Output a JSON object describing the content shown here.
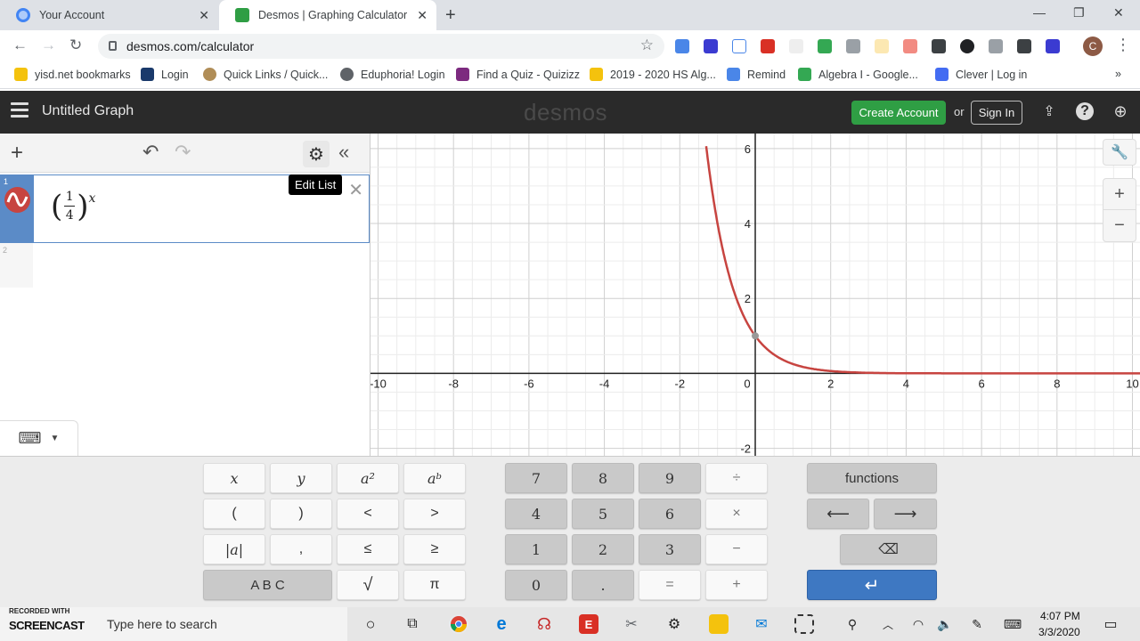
{
  "browser": {
    "tabs": [
      {
        "title": "Your Account"
      },
      {
        "title": "Desmos | Graphing Calculator"
      }
    ],
    "url": "desmos.com/calculator",
    "profile_initial": "C",
    "bookmarks": [
      {
        "label": "yisd.net bookmarks"
      },
      {
        "label": "Login"
      },
      {
        "label": "Quick Links / Quick..."
      },
      {
        "label": "Eduphoria! Login"
      },
      {
        "label": "Find a Quiz - Quizizz"
      },
      {
        "label": "2019 - 2020 HS Alg..."
      },
      {
        "label": "Remind"
      },
      {
        "label": "Algebra I - Google..."
      },
      {
        "label": "Clever | Log in"
      }
    ]
  },
  "desmos": {
    "graph_title": "Untitled Graph",
    "logo": "desmos",
    "create_account": "Create Account",
    "or": "or",
    "sign_in": "Sign In",
    "tooltip": "Edit List",
    "expressions": [
      {
        "index": "1",
        "numerator": "1",
        "denominator": "4",
        "exponent": "x",
        "color": "#c74440"
      },
      {
        "index": "2"
      }
    ]
  },
  "chart_data": {
    "type": "line",
    "title": "",
    "xlabel": "",
    "ylabel": "",
    "xlim": [
      -10.2,
      10.2
    ],
    "ylim": [
      -2.2,
      6.4
    ],
    "x_ticks": [
      "-10",
      "-8",
      "-6",
      "-4",
      "-2",
      "0",
      "2",
      "4",
      "6",
      "8",
      "10"
    ],
    "y_ticks": [
      "-2",
      "2",
      "4",
      "6"
    ],
    "grid": true,
    "series": [
      {
        "function": "(1/4)^x",
        "color": "#c74440",
        "x": [
          -1.3,
          -1.2,
          -1.0,
          -0.8,
          -0.6,
          -0.4,
          -0.2,
          0,
          0.25,
          0.5,
          0.75,
          1,
          1.5,
          2,
          2.5,
          3,
          4,
          5,
          6,
          8,
          10.2
        ],
        "y": [
          6.06,
          5.28,
          4.0,
          3.03,
          2.3,
          1.74,
          1.32,
          1.0,
          0.71,
          0.5,
          0.35,
          0.25,
          0.125,
          0.0625,
          0.031,
          0.016,
          0.004,
          0.001,
          0.0002,
          0.0,
          0.0
        ]
      }
    ],
    "highlight_point": {
      "x": 0,
      "y": 1
    }
  },
  "keypad": {
    "left": [
      [
        "x",
        "y",
        "a²",
        "aᵇ"
      ],
      [
        "(",
        ")",
        "<",
        ">"
      ],
      [
        "|a|",
        ",",
        "≤",
        "≥"
      ],
      [
        "A B C",
        "√",
        "π"
      ]
    ],
    "numbers": [
      [
        "7",
        "8",
        "9",
        "÷"
      ],
      [
        "4",
        "5",
        "6",
        "×"
      ],
      [
        "1",
        "2",
        "3",
        "−"
      ],
      [
        "0",
        ".",
        "=",
        "+"
      ]
    ],
    "functions": "functions",
    "left_arrow": "⟵",
    "right_arrow": "⟶",
    "backspace": "⌫",
    "enter": "↵"
  },
  "taskbar": {
    "search_placeholder": "Type here to search",
    "watermark_top": "RECORDED WITH",
    "watermark_main": "SCREENCAST",
    "time": "4:07 PM",
    "date": "3/3/2020"
  },
  "colors": {
    "header": "#2a2a2a",
    "create_button": "#2f9e44",
    "expression_accent": "#5b8bc7",
    "curve": "#c74440",
    "enter_key": "#3e78c2"
  }
}
